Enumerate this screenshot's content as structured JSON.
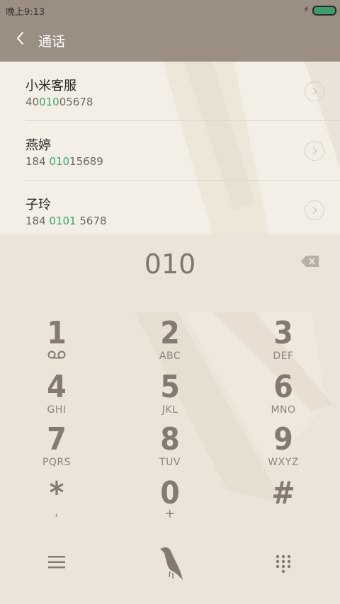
{
  "status": {
    "time": "晚上9:13"
  },
  "appbar": {
    "title": "通话"
  },
  "contacts": [
    {
      "name": "小米客服",
      "num_pre": "40",
      "num_hl": "010",
      "num_post": "05678"
    },
    {
      "name": "燕婷",
      "num_pre": "184 ",
      "num_hl": "010",
      "num_post": "15689"
    },
    {
      "name": "子玲",
      "num_pre": "184 ",
      "num_hl": "0101",
      "num_post": " 5678"
    }
  ],
  "dialer": {
    "input": "010",
    "keys": [
      {
        "digit": "1",
        "letters": ""
      },
      {
        "digit": "2",
        "letters": "ABC"
      },
      {
        "digit": "3",
        "letters": "DEF"
      },
      {
        "digit": "4",
        "letters": "GHI"
      },
      {
        "digit": "5",
        "letters": "JKL"
      },
      {
        "digit": "6",
        "letters": "MNO"
      },
      {
        "digit": "7",
        "letters": "PQRS"
      },
      {
        "digit": "8",
        "letters": "TUV"
      },
      {
        "digit": "9",
        "letters": "WXYZ"
      },
      {
        "digit": "*",
        "letters": ","
      },
      {
        "digit": "0",
        "letters": "+"
      },
      {
        "digit": "#",
        "letters": ""
      }
    ]
  },
  "colors": {
    "bar": "#9b8f84",
    "highlight": "#3aa56f",
    "battery": "#3c9d6a"
  }
}
